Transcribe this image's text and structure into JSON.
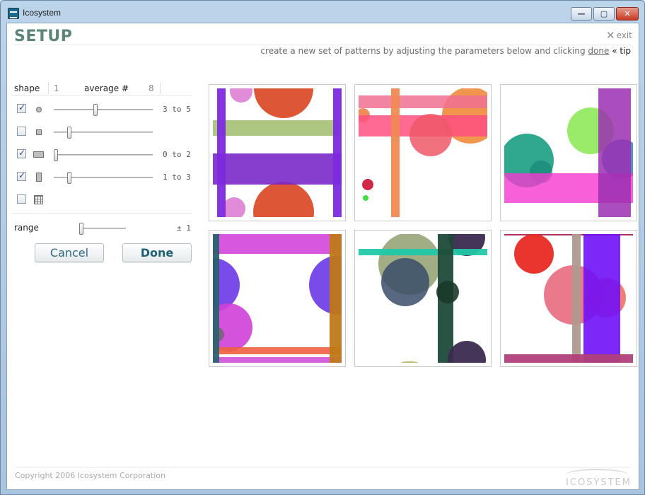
{
  "window": {
    "title": "Icosystem",
    "controls": {
      "minimize": "—",
      "maximize": "▢",
      "close": "✕"
    }
  },
  "header": {
    "title": "SETUP",
    "exit_label": "exit",
    "instruction_prefix": "create a new set of patterns by adjusting the parameters below and clicking",
    "done_link": "done",
    "tip_link": "« tip"
  },
  "panel": {
    "shape_label": "shape",
    "min_label": "1",
    "average_label": "average #",
    "max_label": "8",
    "shapes": [
      {
        "icon": "circle-icon",
        "checked": true,
        "level": 0.42,
        "range_text": "3 to 5"
      },
      {
        "icon": "square-icon",
        "checked": false,
        "level": 0.14,
        "range_text": ""
      },
      {
        "icon": "horizontal-bar-icon",
        "checked": true,
        "level": 0.0,
        "range_text": "0 to 2"
      },
      {
        "icon": "vertical-bar-icon",
        "checked": true,
        "level": 0.14,
        "range_text": "1 to 3"
      },
      {
        "icon": "grid-icon",
        "checked": false,
        "level": null,
        "range_text": ""
      }
    ],
    "range_label": "range",
    "range_level": 0.0,
    "range_value": "± 1",
    "cancel_label": "Cancel",
    "done_label": "Done"
  },
  "footer": {
    "copyright": "Copyright 2006 Icosystem Corporation",
    "logo_text": "ICOSYSTEM"
  }
}
